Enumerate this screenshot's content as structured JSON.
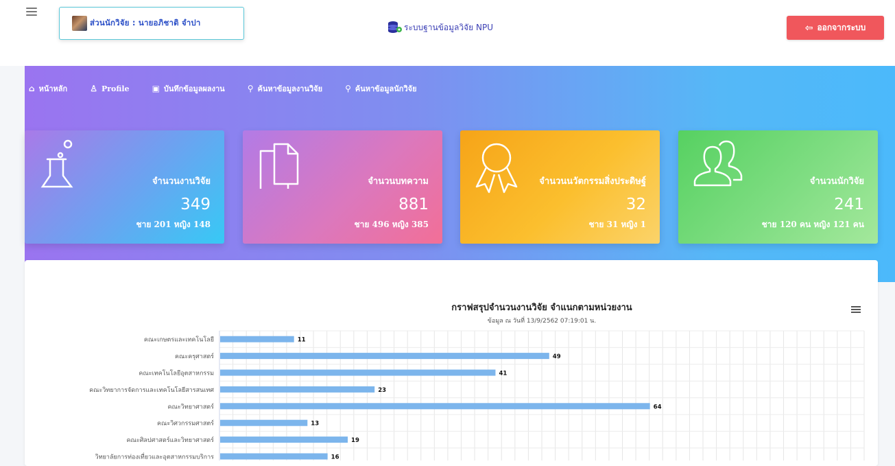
{
  "header": {
    "user_label": "ส่วนนักวิจัย : นายอภิชาติ จำปา",
    "brand_text": "ระบบฐานข้อมูลวิจัย NPU",
    "logout_label": "ออกจากระบบ"
  },
  "nav": [
    {
      "icon": "home-icon",
      "label": "หน้าหลัก"
    },
    {
      "icon": "user-icon",
      "label": "Profile"
    },
    {
      "icon": "save-icon",
      "label": "บันทึกข้อมูลผลงาน"
    },
    {
      "icon": "search-icon",
      "label": "ค้นหาข้อมูลงานวิจัย"
    },
    {
      "icon": "search-icon",
      "label": "ค้นหาข้อมูลนักวิจัย"
    }
  ],
  "cards": [
    {
      "icon": "flask-icon",
      "title": "จำนวนงานวิจัย",
      "value": "349",
      "sub": "ชาย 201 หญิง 148"
    },
    {
      "icon": "document-icon",
      "title": "จำนวนบทความ",
      "value": "881",
      "sub": "ชาย 496 หญิง 385"
    },
    {
      "icon": "award-icon",
      "title": "จำนวนนวัตกรรมสิ่งประดิษฐ์",
      "value": "32",
      "sub": "ชาย 31 หญิง 1"
    },
    {
      "icon": "users-icon",
      "title": "จำนวนนักวิจัย",
      "value": "241",
      "sub": "ชาย 120 คน หญิง 121 คน"
    }
  ],
  "colors": {
    "bar": "#7cb5ec",
    "logout": "#f0575c",
    "brand": "#3b3fb5"
  },
  "chart_data": {
    "type": "bar",
    "orientation": "horizontal",
    "title": "กราฟสรุปจำนวนงานวิจัย จำแนกตามหน่วยงาน",
    "subtitle": "ข้อมูล ณ วันที่ 13/9/2562 07:19:01 น.",
    "categories": [
      "คณะเกษตรและเทคโนโลยี",
      "คณะครุศาสตร์",
      "คณะเทคโนโลยีอุตสาหกรรม",
      "คณะวิทยาการจัดการและเทคโนโลยีสารสนเทศ",
      "คณะวิทยาศาสตร์",
      "คณะวิศวกรรมศาสตร์",
      "คณะศิลปศาสตร์และวิทยาศาสตร์",
      "วิทยาลัยการท่องเที่ยวและอุตสาหกรรมบริการ"
    ],
    "values": [
      11,
      49,
      41,
      23,
      64,
      13,
      19,
      16
    ],
    "xlim": [
      0,
      96
    ],
    "grid": true
  }
}
